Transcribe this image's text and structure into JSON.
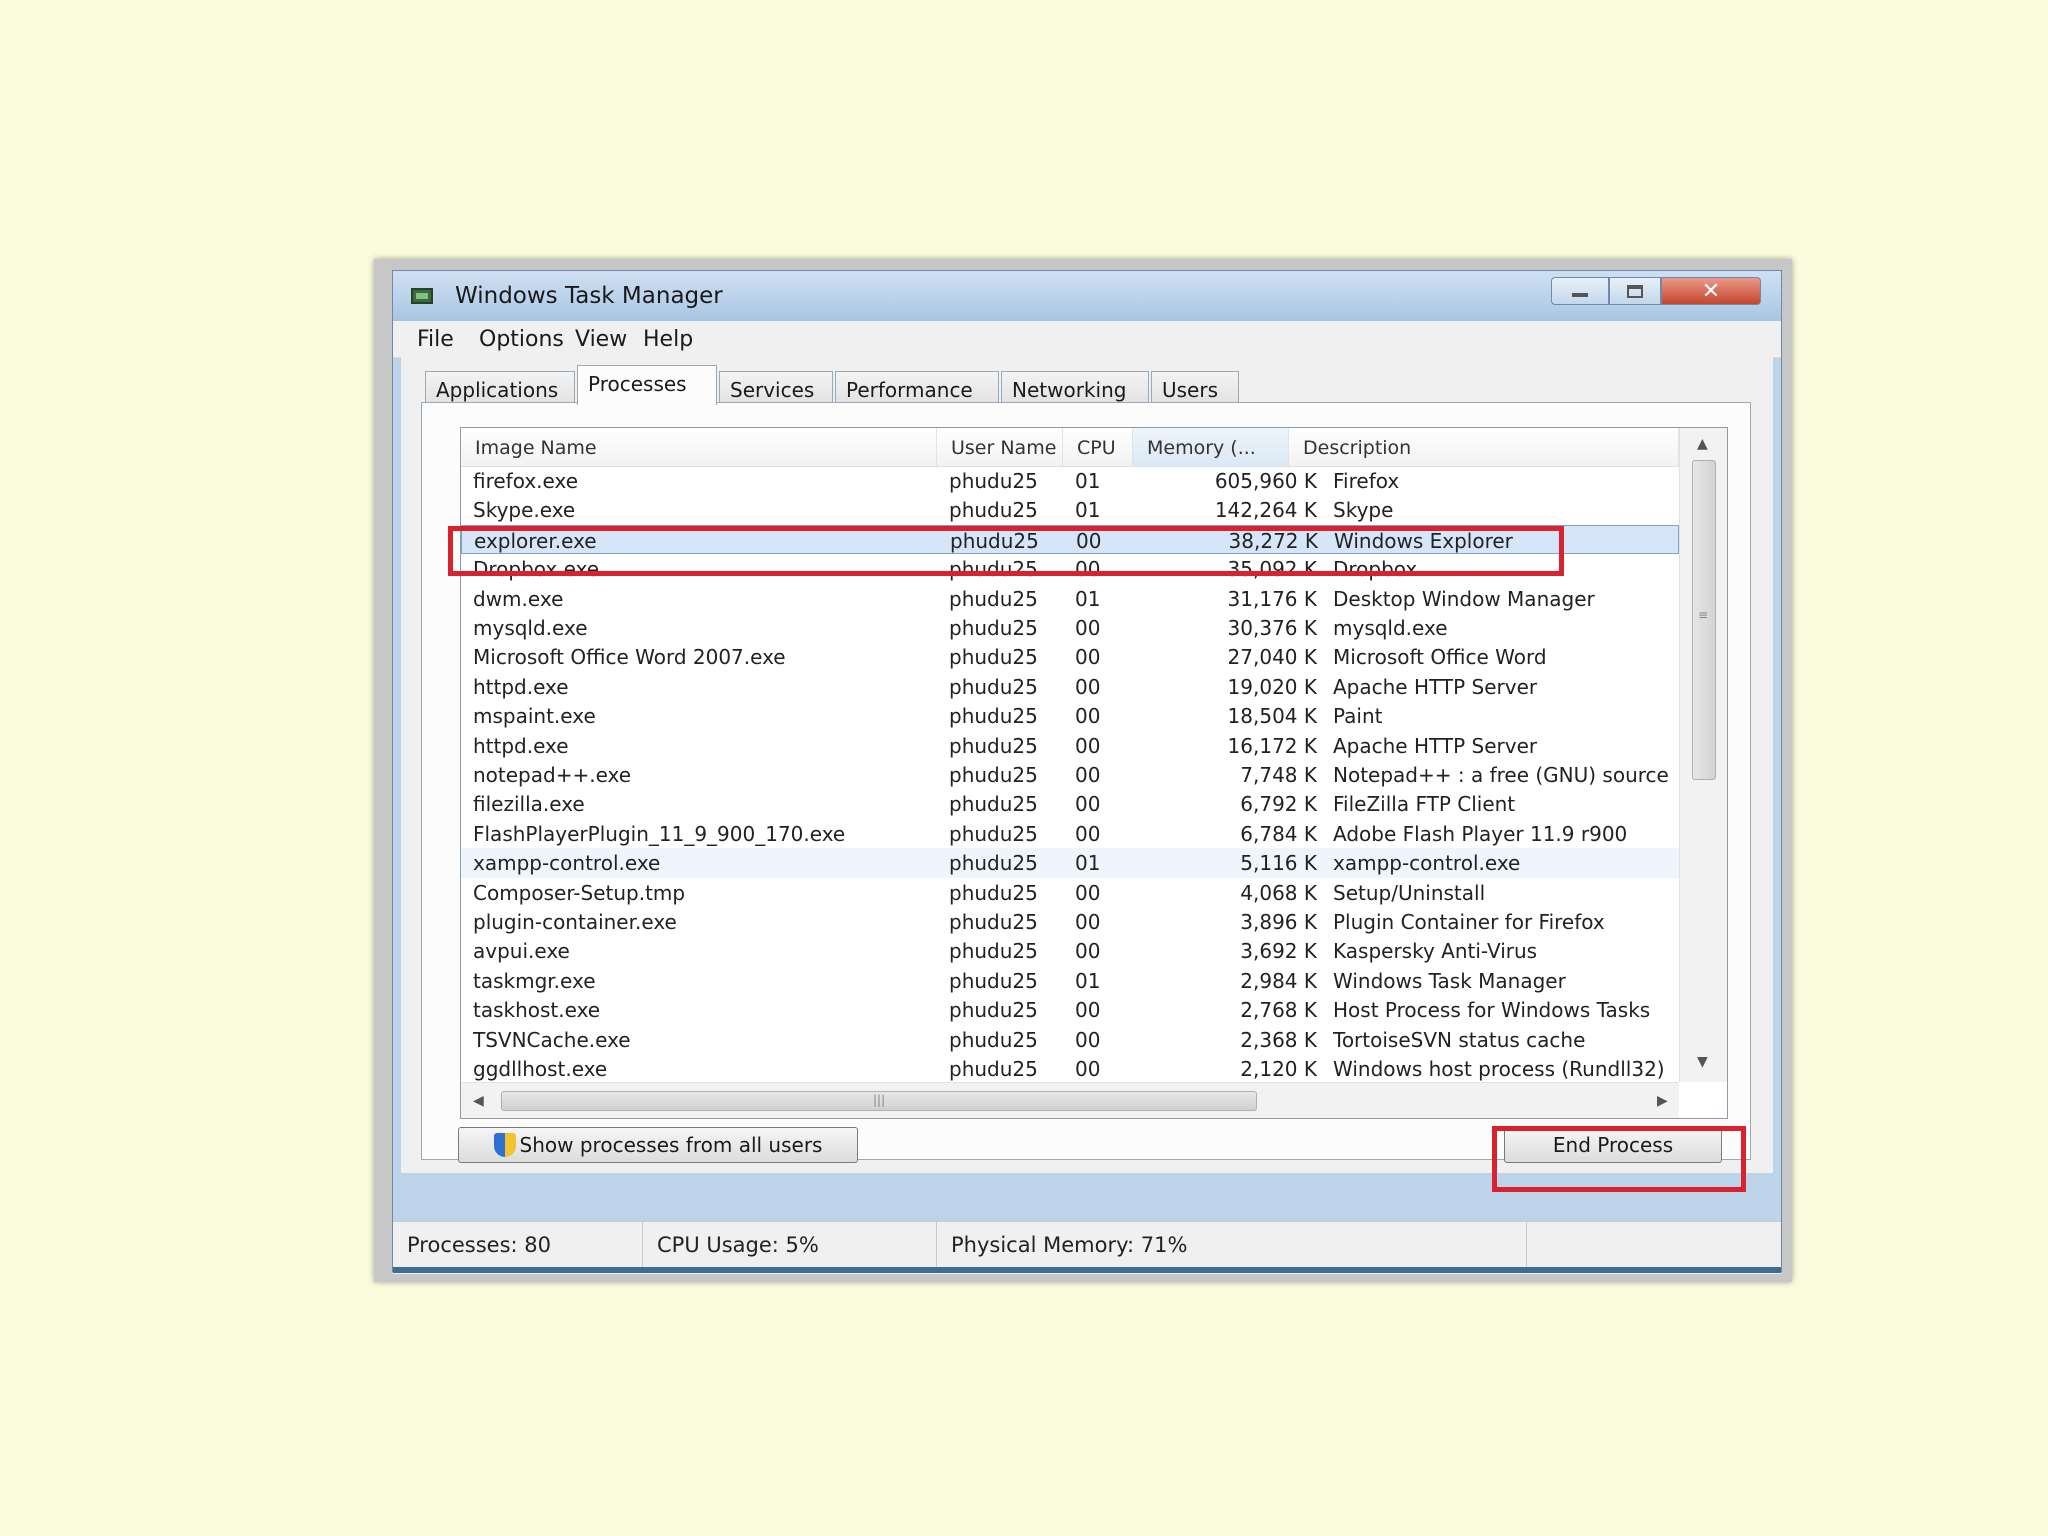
{
  "window": {
    "title": "Windows Task Manager",
    "minimize_label": "minimize",
    "maximize_label": "maximize",
    "close_label": "✕"
  },
  "menu": [
    "File",
    "Options",
    "View",
    "Help"
  ],
  "tabs": [
    {
      "label": "Applications",
      "active": false
    },
    {
      "label": "Processes",
      "active": true
    },
    {
      "label": "Services",
      "active": false
    },
    {
      "label": "Performance",
      "active": false
    },
    {
      "label": "Networking",
      "active": false
    },
    {
      "label": "Users",
      "active": false
    }
  ],
  "table": {
    "headers": {
      "name": "Image Name",
      "user": "User Name",
      "cpu": "CPU",
      "memory": "Memory (...",
      "description": "Description"
    },
    "rows": [
      {
        "name": "firefox.exe",
        "user": "phudu25",
        "cpu": "01",
        "memory": "605,960 K",
        "description": "Firefox"
      },
      {
        "name": "Skype.exe",
        "user": "phudu25",
        "cpu": "01",
        "memory": "142,264 K",
        "description": "Skype"
      },
      {
        "name": "explorer.exe",
        "user": "phudu25",
        "cpu": "00",
        "memory": "38,272 K",
        "description": "Windows Explorer"
      },
      {
        "name": "Dropbox.exe",
        "user": "phudu25",
        "cpu": "00",
        "memory": "35,092 K",
        "description": "Dropbox"
      },
      {
        "name": "dwm.exe",
        "user": "phudu25",
        "cpu": "01",
        "memory": "31,176 K",
        "description": "Desktop Window Manager"
      },
      {
        "name": "mysqld.exe",
        "user": "phudu25",
        "cpu": "00",
        "memory": "30,376 K",
        "description": "mysqld.exe"
      },
      {
        "name": "Microsoft Office Word 2007.exe",
        "user": "phudu25",
        "cpu": "00",
        "memory": "27,040 K",
        "description": "Microsoft Office Word"
      },
      {
        "name": "httpd.exe",
        "user": "phudu25",
        "cpu": "00",
        "memory": "19,020 K",
        "description": "Apache HTTP Server"
      },
      {
        "name": "mspaint.exe",
        "user": "phudu25",
        "cpu": "00",
        "memory": "18,504 K",
        "description": "Paint"
      },
      {
        "name": "httpd.exe",
        "user": "phudu25",
        "cpu": "00",
        "memory": "16,172 K",
        "description": "Apache HTTP Server"
      },
      {
        "name": "notepad++.exe",
        "user": "phudu25",
        "cpu": "00",
        "memory": "7,748 K",
        "description": "Notepad++ : a free (GNU) source"
      },
      {
        "name": "filezilla.exe",
        "user": "phudu25",
        "cpu": "00",
        "memory": "6,792 K",
        "description": "FileZilla FTP Client"
      },
      {
        "name": "FlashPlayerPlugin_11_9_900_170.exe",
        "user": "phudu25",
        "cpu": "00",
        "memory": "6,784 K",
        "description": "Adobe Flash Player 11.9 r900"
      },
      {
        "name": "xampp-control.exe",
        "user": "phudu25",
        "cpu": "01",
        "memory": "5,116 K",
        "description": "xampp-control.exe"
      },
      {
        "name": "Composer-Setup.tmp",
        "user": "phudu25",
        "cpu": "00",
        "memory": "4,068 K",
        "description": "Setup/Uninstall"
      },
      {
        "name": "plugin-container.exe",
        "user": "phudu25",
        "cpu": "00",
        "memory": "3,896 K",
        "description": "Plugin Container for Firefox"
      },
      {
        "name": "avpui.exe",
        "user": "phudu25",
        "cpu": "00",
        "memory": "3,692 K",
        "description": "Kaspersky Anti-Virus"
      },
      {
        "name": "taskmgr.exe",
        "user": "phudu25",
        "cpu": "01",
        "memory": "2,984 K",
        "description": "Windows Task Manager"
      },
      {
        "name": "taskhost.exe",
        "user": "phudu25",
        "cpu": "00",
        "memory": "2,768 K",
        "description": "Host Process for Windows Tasks"
      },
      {
        "name": "TSVNCache.exe",
        "user": "phudu25",
        "cpu": "00",
        "memory": "2,368 K",
        "description": "TortoiseSVN status cache"
      },
      {
        "name": "ggdllhost.exe",
        "user": "phudu25",
        "cpu": "00",
        "memory": "2,120 K",
        "description": "Windows host process (Rundll32)"
      }
    ],
    "selected_row": 2,
    "hover_row": 13
  },
  "buttons": {
    "show_all": "Show processes from all users",
    "end_process": "End Process"
  },
  "status": {
    "processes": "Processes: 80",
    "cpu": "CPU Usage: 5%",
    "memory": "Physical Memory: 71%"
  },
  "colors": {
    "background": "#fbfbdd",
    "highlight": "#d8232e",
    "selected_row": "#d6e6f8"
  }
}
